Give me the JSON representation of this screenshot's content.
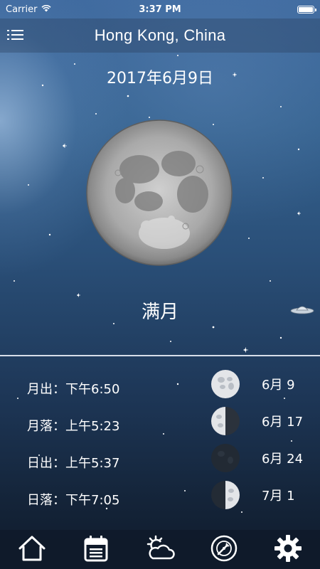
{
  "status_bar": {
    "carrier": "Carrier",
    "time": "3:37 PM"
  },
  "header": {
    "title": "Hong Kong, China"
  },
  "main": {
    "date": "2017年6月9日",
    "phase_name": "满月"
  },
  "times": [
    {
      "label": "月出：下午6:50"
    },
    {
      "label": "月落：上午5:23"
    },
    {
      "label": "日出：上午5:37"
    },
    {
      "label": "日落：下午7:05"
    }
  ],
  "upcoming_phases": [
    {
      "date": "6月 9",
      "icon": "full-moon-icon"
    },
    {
      "date": "6月 17",
      "icon": "last-quarter-icon"
    },
    {
      "date": "6月 24",
      "icon": "new-moon-icon"
    },
    {
      "date": "7月 1",
      "icon": "first-quarter-icon"
    }
  ],
  "tabs": [
    {
      "icon": "home-icon"
    },
    {
      "icon": "calendar-icon"
    },
    {
      "icon": "weather-icon"
    },
    {
      "icon": "compass-icon"
    },
    {
      "icon": "settings-icon"
    }
  ],
  "colors": {
    "sky_top": "#3f6a9f",
    "sky_bottom": "#0f1a2a",
    "tabbar": "#0f1a2a",
    "text": "#ffffff"
  }
}
